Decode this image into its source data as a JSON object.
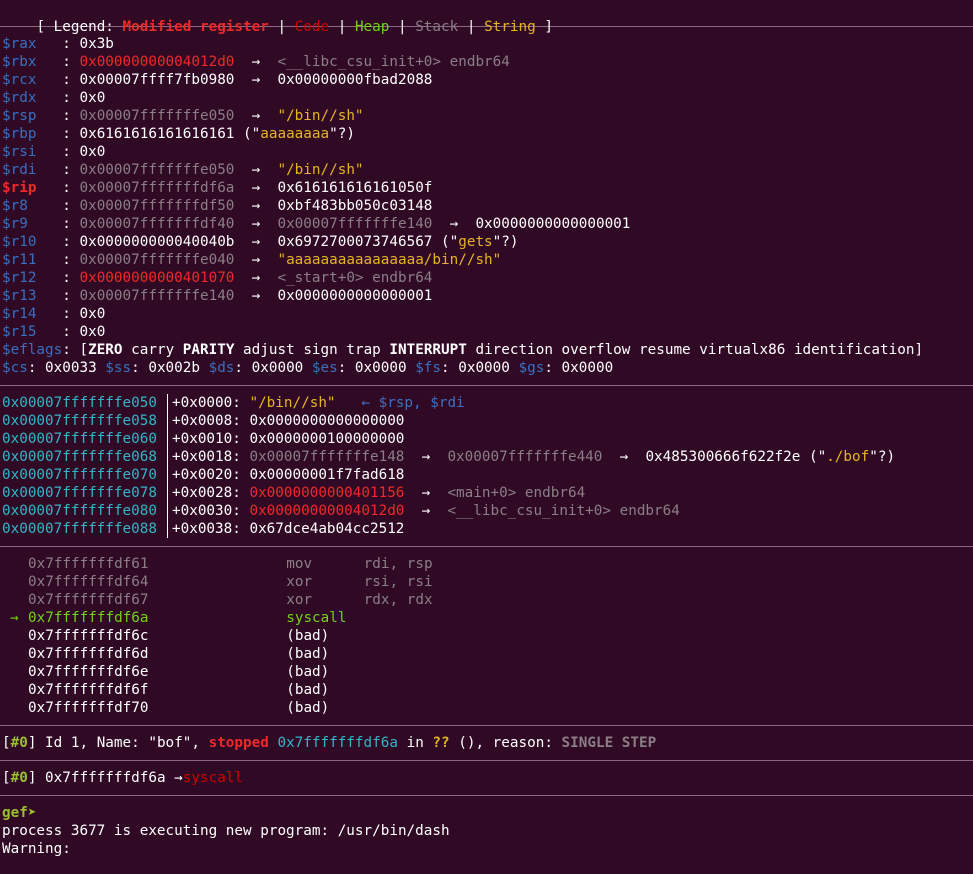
{
  "legend": {
    "open": "[ Legend: ",
    "modified": "Modified register",
    "code": "Code",
    "heap": "Heap",
    "stack": "Stack",
    "string": "String",
    "sep": " | ",
    "close": " ]"
  },
  "registers": [
    {
      "name": "$rax   ",
      "value": "0x3b",
      "vcolor": "white",
      "rest": []
    },
    {
      "name": "$rbx   ",
      "value": "0x00000000004012d0",
      "vcolor": "red",
      "rest": [
        {
          "t": "  →  ",
          "c": "white"
        },
        {
          "t": "<__libc_csu_init+0> endbr64",
          "c": "gray"
        }
      ]
    },
    {
      "name": "$rcx   ",
      "value": "0x00007ffff7fb0980",
      "vcolor": "white",
      "rest": [
        {
          "t": "  →  ",
          "c": "white"
        },
        {
          "t": "0x00000000fbad2088",
          "c": "white"
        }
      ]
    },
    {
      "name": "$rdx   ",
      "value": "0x0",
      "vcolor": "white",
      "rest": []
    },
    {
      "name": "$rsp   ",
      "value": "0x00007fffffffe050",
      "vcolor": "gray",
      "rest": [
        {
          "t": "  →  ",
          "c": "white"
        },
        {
          "t": "\"/bin//sh\"",
          "c": "yellow"
        }
      ]
    },
    {
      "name": "$rbp   ",
      "value": "0x6161616161616161",
      "vcolor": "white",
      "rest": [
        {
          "t": " (\"",
          "c": "white"
        },
        {
          "t": "aaaaaaaa",
          "c": "yellow"
        },
        {
          "t": "\"?)",
          "c": "white"
        }
      ]
    },
    {
      "name": "$rsi   ",
      "value": "0x0",
      "vcolor": "white",
      "rest": []
    },
    {
      "name": "$rdi   ",
      "value": "0x00007fffffffe050",
      "vcolor": "gray",
      "rest": [
        {
          "t": "  →  ",
          "c": "white"
        },
        {
          "t": "\"/bin//sh\"",
          "c": "yellow"
        }
      ]
    },
    {
      "name": "$rip   ",
      "value": "0x00007fffffffdf6a",
      "vcolor": "gray",
      "nameMod": true,
      "rest": [
        {
          "t": "  →  ",
          "c": "white"
        },
        {
          "t": "0x616161616161050f",
          "c": "white"
        }
      ]
    },
    {
      "name": "$r8    ",
      "value": "0x00007fffffffdf50",
      "vcolor": "gray",
      "rest": [
        {
          "t": "  →  ",
          "c": "white"
        },
        {
          "t": "0xbf483bb050c03148",
          "c": "white"
        }
      ]
    },
    {
      "name": "$r9    ",
      "value": "0x00007fffffffdf40",
      "vcolor": "gray",
      "rest": [
        {
          "t": "  →  ",
          "c": "white"
        },
        {
          "t": "0x00007fffffffe140",
          "c": "gray"
        },
        {
          "t": "  →  ",
          "c": "white"
        },
        {
          "t": "0x0000000000000001",
          "c": "white"
        }
      ]
    },
    {
      "name": "$r10   ",
      "value": "0x000000000040040b",
      "vcolor": "white",
      "rest": [
        {
          "t": "  →  ",
          "c": "white"
        },
        {
          "t": "0x6972700073746567 (\"",
          "c": "white"
        },
        {
          "t": "gets",
          "c": "yellow"
        },
        {
          "t": "\"?)",
          "c": "white"
        }
      ]
    },
    {
      "name": "$r11   ",
      "value": "0x00007fffffffe040",
      "vcolor": "gray",
      "rest": [
        {
          "t": "  →  ",
          "c": "white"
        },
        {
          "t": "\"aaaaaaaaaaaaaaaa/bin//sh\"",
          "c": "yellow"
        }
      ]
    },
    {
      "name": "$r12   ",
      "value": "0x0000000000401070",
      "vcolor": "red",
      "rest": [
        {
          "t": "  →  ",
          "c": "white"
        },
        {
          "t": "<_start+0> endbr64",
          "c": "gray"
        }
      ]
    },
    {
      "name": "$r13   ",
      "value": "0x00007fffffffe140",
      "vcolor": "gray",
      "rest": [
        {
          "t": "  →  ",
          "c": "white"
        },
        {
          "t": "0x0000000000000001",
          "c": "white"
        }
      ]
    },
    {
      "name": "$r14   ",
      "value": "0x0",
      "vcolor": "white",
      "rest": []
    },
    {
      "name": "$r15   ",
      "value": "0x0",
      "vcolor": "white",
      "rest": []
    }
  ],
  "eflags": {
    "label": "$eflags",
    "parts": [
      {
        "t": ": [",
        "b": false
      },
      {
        "t": "ZERO",
        "b": true
      },
      {
        "t": " carry ",
        "b": false
      },
      {
        "t": "PARITY",
        "b": true
      },
      {
        "t": " adjust sign trap ",
        "b": false
      },
      {
        "t": "INTERRUPT",
        "b": true
      },
      {
        "t": " direction overflow resume virtualx86 identification]",
        "b": false
      }
    ]
  },
  "segments": [
    {
      "name": "$cs",
      "value": "0x0033"
    },
    {
      "name": "$ss",
      "value": "0x002b"
    },
    {
      "name": "$ds",
      "value": "0x0000"
    },
    {
      "name": "$es",
      "value": "0x0000"
    },
    {
      "name": "$fs",
      "value": "0x0000"
    },
    {
      "name": "$gs",
      "value": "0x0000"
    }
  ],
  "stack": [
    {
      "addr": "0x00007fffffffe050",
      "rest": [
        {
          "t": "+0x0000: ",
          "c": "white"
        },
        {
          "t": "\"/bin//sh\"",
          "c": "yellow"
        },
        {
          "t": "   ← $rsp, $rdi",
          "c": "blue"
        }
      ]
    },
    {
      "addr": "0x00007fffffffe058",
      "rest": [
        {
          "t": "+0x0008: ",
          "c": "white"
        },
        {
          "t": "0x0000000000000000",
          "c": "white"
        }
      ]
    },
    {
      "addr": "0x00007fffffffe060",
      "rest": [
        {
          "t": "+0x0010: ",
          "c": "white"
        },
        {
          "t": "0x0000000100000000",
          "c": "white"
        }
      ]
    },
    {
      "addr": "0x00007fffffffe068",
      "rest": [
        {
          "t": "+0x0018: ",
          "c": "white"
        },
        {
          "t": "0x00007fffffffe148",
          "c": "gray"
        },
        {
          "t": "  →  ",
          "c": "white"
        },
        {
          "t": "0x00007fffffffe440",
          "c": "gray"
        },
        {
          "t": "  →  ",
          "c": "white"
        },
        {
          "t": "0x485300666f622f2e (\"",
          "c": "white"
        },
        {
          "t": "./bof",
          "c": "yellow"
        },
        {
          "t": "\"?)",
          "c": "white"
        }
      ]
    },
    {
      "addr": "0x00007fffffffe070",
      "rest": [
        {
          "t": "+0x0020: ",
          "c": "white"
        },
        {
          "t": "0x00000001f7fad618",
          "c": "white"
        }
      ]
    },
    {
      "addr": "0x00007fffffffe078",
      "rest": [
        {
          "t": "+0x0028: ",
          "c": "white"
        },
        {
          "t": "0x0000000000401156",
          "c": "red"
        },
        {
          "t": "  →  ",
          "c": "white"
        },
        {
          "t": "<main+0> endbr64",
          "c": "gray"
        }
      ]
    },
    {
      "addr": "0x00007fffffffe080",
      "rest": [
        {
          "t": "+0x0030: ",
          "c": "white"
        },
        {
          "t": "0x00000000004012d0",
          "c": "red"
        },
        {
          "t": "  →  ",
          "c": "white"
        },
        {
          "t": "<__libc_csu_init+0> endbr64",
          "c": "gray"
        }
      ]
    },
    {
      "addr": "0x00007fffffffe088",
      "rest": [
        {
          "t": "+0x0038: ",
          "c": "white"
        },
        {
          "t": "0x67dce4ab04cc2512",
          "c": "white"
        }
      ]
    }
  ],
  "code": [
    {
      "addr": "0x7fffffffdf61",
      "mn": "mov",
      "ops": "rdi, rsp",
      "state": "past"
    },
    {
      "addr": "0x7fffffffdf64",
      "mn": "xor",
      "ops": "rsi, rsi",
      "state": "past"
    },
    {
      "addr": "0x7fffffffdf67",
      "mn": "xor",
      "ops": "rdx, rdx",
      "state": "past"
    },
    {
      "addr": "0x7fffffffdf6a",
      "mn": "syscall",
      "ops": "",
      "state": "current"
    },
    {
      "addr": "0x7fffffffdf6c",
      "mn": "(bad)",
      "ops": "",
      "state": "future"
    },
    {
      "addr": "0x7fffffffdf6d",
      "mn": "(bad)",
      "ops": "",
      "state": "future"
    },
    {
      "addr": "0x7fffffffdf6e",
      "mn": "(bad)",
      "ops": "",
      "state": "future"
    },
    {
      "addr": "0x7fffffffdf6f",
      "mn": "(bad)",
      "ops": "",
      "state": "future"
    },
    {
      "addr": "0x7fffffffdf70",
      "mn": "(bad)",
      "ops": "",
      "state": "future"
    }
  ],
  "code_arrow": "→",
  "thread": {
    "open": "[",
    "id": "#0",
    "close": "] ",
    "text1": "Id 1, Name: \"bof\", ",
    "stopped": "stopped",
    "addr": " 0x7fffffffdf6a",
    "text2": " in ",
    "qq": "??",
    "text3": " (), reason: ",
    "reason": "SINGLE STEP"
  },
  "trace": {
    "open": "[",
    "id": "#0",
    "close": "] ",
    "addr": "0x7fffffffdf6a ",
    "arrow": "→",
    "instr": "syscall"
  },
  "prompt": "gef➤",
  "output": [
    "process 3677 is executing new program: /usr/bin/dash",
    "Warning:"
  ]
}
